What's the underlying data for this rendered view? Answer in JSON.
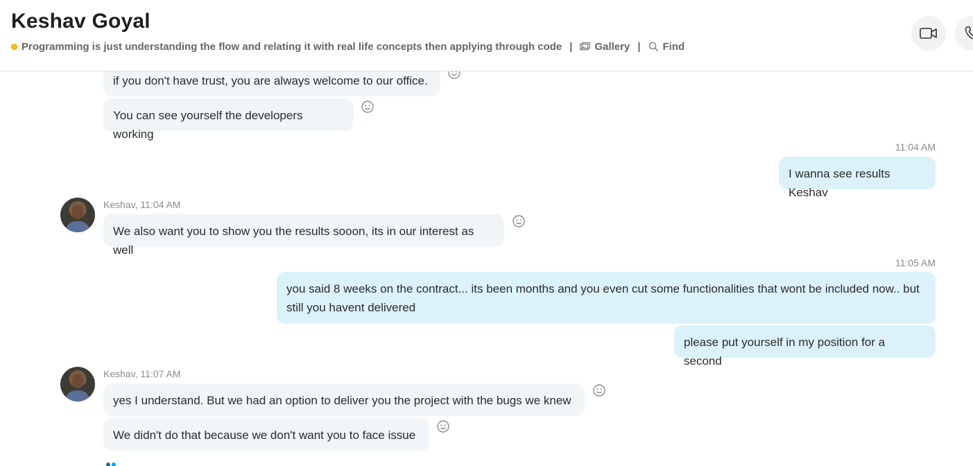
{
  "header": {
    "title": "Keshav Goyal",
    "status_message": "Programming is just understanding the flow and relating it with real life concepts then applying through code",
    "separator": "|",
    "gallery_label": "Gallery",
    "find_label": "Find",
    "mood_icon": "status-dot-icon",
    "status_color": "#f5c518"
  },
  "messages": {
    "m1": {
      "text": "if you don't have trust, you are always welcome to our office."
    },
    "m2": {
      "text": "You can see yourself the developers working"
    },
    "t1": "11:04 AM",
    "m3": {
      "text": "I wanna see results Keshav"
    },
    "s1": "Keshav, 11:04 AM",
    "m4": {
      "text": "We also want you to show you the results sooon, its in our interest as well"
    },
    "t2": "11:05 AM",
    "m5": {
      "text": "you said 8 weeks on the contract... its been months and you even cut some functionalities that wont be included now.. but still you havent delivered"
    },
    "m6": {
      "text": "please put yourself in my position for a second"
    },
    "s2": "Keshav, 11:07 AM",
    "m7": {
      "text": "yes I understand. But we had an option to deliver you the project with the bugs we knew"
    },
    "m8": {
      "text": "We didn't do that because we don't want you to face issue"
    }
  },
  "colors": {
    "incoming_bubble": "#f1f5f8",
    "outgoing_bubble": "#dcf2fb",
    "accent": "#00a2ed"
  }
}
